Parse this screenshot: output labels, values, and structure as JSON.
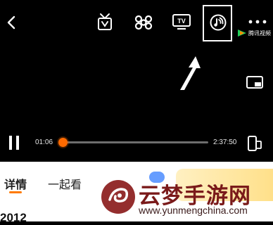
{
  "top_bar": {
    "back_icon": "chevron-left-icon",
    "icons": [
      "gift-box-icon",
      "china-unicom-icon",
      "tv-cast-icon",
      "audio-mode-icon",
      "more-icon"
    ],
    "brand_name": "腾讯视频"
  },
  "player": {
    "current_time": "01:06",
    "duration": "2:37:50",
    "progress": 0.007,
    "state_icon": "pause-icon"
  },
  "tabs": {
    "details": "详情",
    "watch_together": "一起看"
  },
  "content": {
    "year": "2012"
  },
  "watermark": {
    "text": "云梦手游网",
    "url": "www.yunmengchina.com"
  },
  "colors": {
    "accent": "#ff6a00",
    "background": "#000000",
    "watermark": "#7a1a1a"
  }
}
